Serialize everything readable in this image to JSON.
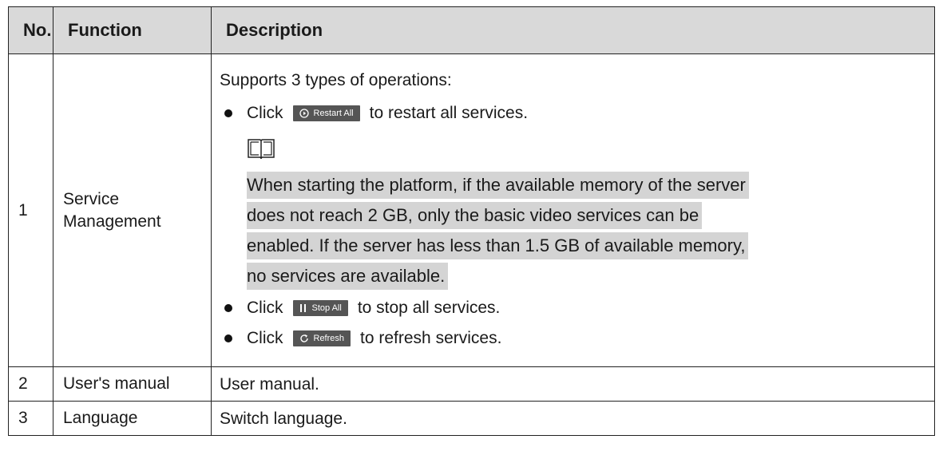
{
  "table": {
    "headers": [
      "No.",
      "Function",
      "Description"
    ],
    "rows": [
      {
        "no": "1",
        "function": "Service Management",
        "description": {
          "intro": "Supports 3 types of operations:",
          "restart": {
            "before": "Click",
            "button": "Restart All",
            "after": "to restart all services."
          },
          "note_lines": [
            "When starting the platform, if the available memory of the server",
            "does not reach 2 GB, only the basic video services can be ",
            "enabled. If the server has less than 1.5 GB of available memory,",
            "no services are available."
          ],
          "stop": {
            "before": "Click",
            "button": "Stop All",
            "after": "to stop all services."
          },
          "refresh": {
            "before": "Click",
            "button": "Refresh",
            "after": "to refresh services."
          }
        }
      },
      {
        "no": "2",
        "function": "User's manual",
        "description": "User manual."
      },
      {
        "no": "3",
        "function": "Language",
        "description": "Switch language."
      }
    ]
  },
  "icons": {
    "restart": "play-circle-icon",
    "note": "open-book-icon",
    "stop": "pause-icon",
    "refresh": "refresh-icon"
  },
  "colors": {
    "header_bg": "#d9d9d9",
    "note_highlight": "#d4d4d4",
    "button_bg": "#555555"
  }
}
